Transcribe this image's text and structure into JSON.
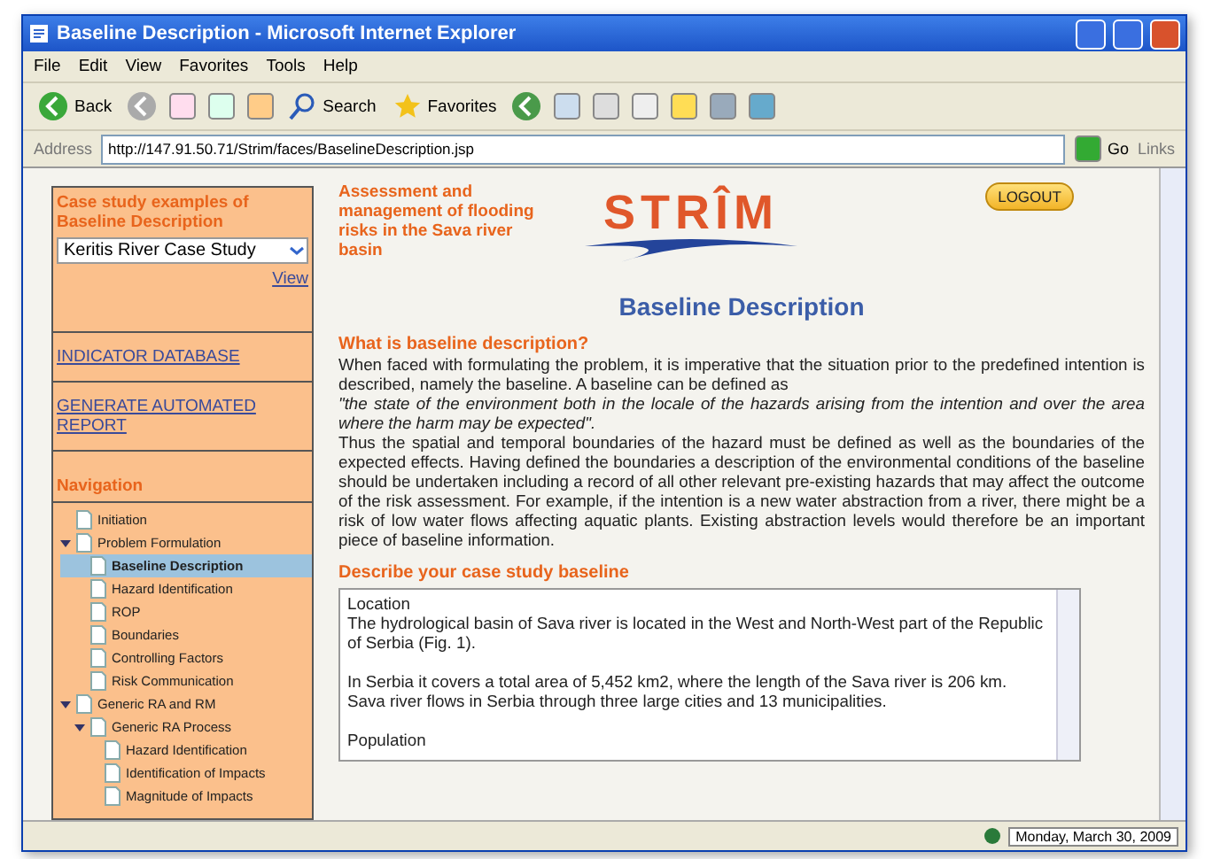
{
  "window": {
    "title": "Baseline Description - Microsoft Internet Explorer"
  },
  "menu": [
    "File",
    "Edit",
    "View",
    "Favorites",
    "Tools",
    "Help"
  ],
  "toolbar": [
    {
      "kind": "back",
      "label": "Back"
    },
    {
      "kind": "search",
      "label": "Search"
    },
    {
      "kind": "favorites",
      "label": "Favorites"
    }
  ],
  "address": {
    "label": "Address",
    "url": "http://147.91.50.71/Strim/faces/BaselineDescription.jsp",
    "go": "Go",
    "links": "Links"
  },
  "sidebar": {
    "case_title": "Case study examples of Baseline Description",
    "case_select": "Keritis River Case Study",
    "view_link": "View",
    "links": [
      "INDICATOR DATABASE",
      "GENERATE AUTOMATED REPORT"
    ],
    "nav_title": "Navigation",
    "tree": [
      {
        "label": "Initiation",
        "selected": false
      },
      {
        "label": "Problem Formulation",
        "selected": false,
        "expanded": true,
        "children": [
          {
            "label": "Baseline Description",
            "selected": true
          },
          {
            "label": "Hazard Identification",
            "selected": false
          },
          {
            "label": "ROP",
            "selected": false
          },
          {
            "label": "Boundaries",
            "selected": false
          },
          {
            "label": "Controlling Factors",
            "selected": false
          },
          {
            "label": "Risk Communication",
            "selected": false
          }
        ]
      },
      {
        "label": "Generic RA and RM",
        "selected": false,
        "expanded": true,
        "children": [
          {
            "label": "Generic RA Process",
            "selected": false,
            "expanded": true,
            "children": [
              {
                "label": "Hazard Identification",
                "selected": false
              },
              {
                "label": "Identification of Impacts",
                "selected": false
              },
              {
                "label": "Magnitude of Impacts",
                "selected": false
              }
            ]
          }
        ]
      }
    ]
  },
  "page": {
    "tagline": "Assessment and management of flooding risks in the Sava river basin",
    "logo": "STRÎM",
    "logout": "LOGOUT",
    "heading": "Baseline Description",
    "question": "What is baseline description?",
    "intro": "When faced with formulating the problem, it is imperative that the situation prior to the predefined intention is described, namely the baseline. A baseline can be defined as",
    "quote": "\"the state of the environment both in the locale of the hazards arising from the intention and over the area where the harm may be expected\".",
    "body": "Thus the spatial and temporal boundaries of the hazard must be defined as well as the boundaries of the expected effects. Having defined the boundaries a description of the environmental conditions of the baseline should be undertaken including a record of all other relevant pre-existing hazards that may affect the outcome of the risk assessment. For example, if the intention is a new water abstraction from a river, there might be a risk of low water flows affecting aquatic plants. Existing abstraction levels would therefore be an important piece of baseline information.",
    "describe_title": "Describe your case study baseline",
    "baseline_text": "Location\nThe hydrological basin of Sava river is located in the West and North-West part of the Republic of Serbia (Fig. 1).\n\nIn Serbia it covers a total area of 5,452 km2, where the length of the Sava river is 206 km. Sava river flows in Serbia through three large cities and 13 municipalities.\n\nPopulation"
  },
  "status_bar": {
    "date": "Monday, March 30, 2009"
  }
}
